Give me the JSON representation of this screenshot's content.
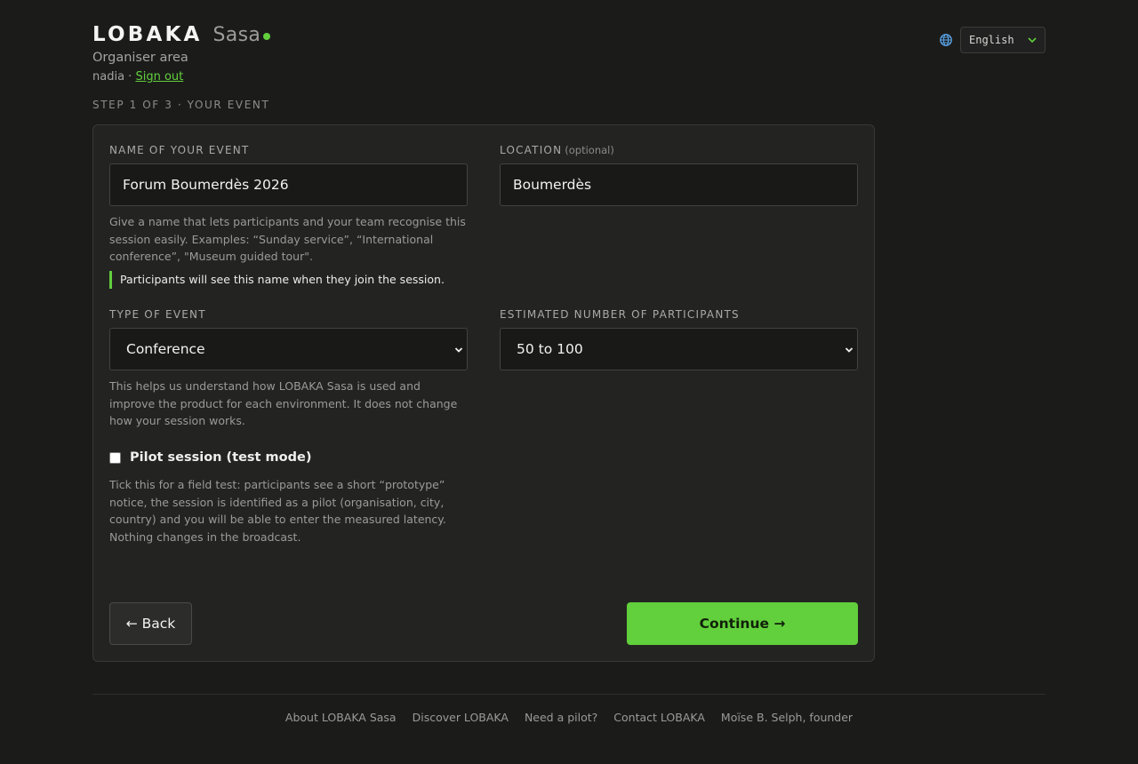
{
  "brand": {
    "name": "LOBAKA",
    "sub": "Sasa",
    "area": "Organiser area",
    "user": "nadia",
    "separator": " · ",
    "signout": "Sign out"
  },
  "step": "STEP 1 OF 3 · YOUR EVENT",
  "language": {
    "selected": "English"
  },
  "form": {
    "name_label": "NAME OF YOUR EVENT",
    "name_value": "Forum Boumerdès 2026",
    "name_help": "Give a name that lets participants and your team recognise this session easily. Examples: “Sunday service”, “International conference”, \"Museum guided tour\".",
    "name_note": "Participants will see this name when they join the session.",
    "location_label": "LOCATION",
    "location_optional": "(optional)",
    "location_value": "Boumerdès",
    "type_label": "TYPE OF EVENT",
    "type_value": "Conference",
    "type_help": "This helps us understand how LOBAKA Sasa is used and improve the product for each environment. It does not change how your session works.",
    "participants_label": "ESTIMATED NUMBER OF PARTICIPANTS",
    "participants_value": "50 to 100",
    "pilot_label": "Pilot session (test mode)",
    "pilot_checked": false,
    "pilot_help": "Tick this for a field test: participants see a short “prototype” notice, the session is identified as a pilot (organisation, city, country) and you will be able to enter the measured latency. Nothing changes in the broadcast.",
    "back_label": "← Back",
    "continue_label": "Continue →"
  },
  "footer": {
    "links": [
      "About LOBAKA Sasa",
      "Discover LOBAKA",
      "Need a pilot?",
      "Contact LOBAKA",
      "Moïse B. Selph, founder"
    ]
  },
  "colors": {
    "accent": "#62cf3c",
    "background": "#1b1c1a",
    "card": "#232422"
  }
}
